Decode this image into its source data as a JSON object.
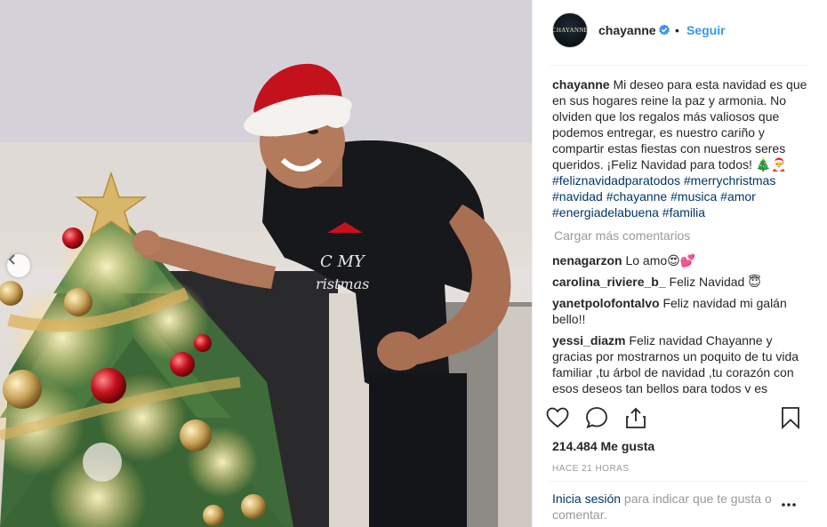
{
  "header": {
    "avatar_text": "CHAYANNE",
    "username": "chayanne",
    "separator": "•",
    "follow_label": "Seguir"
  },
  "caption": {
    "user": "chayanne",
    "text": "Mi deseo para esta navidad es que en sus hogares reine la paz y armonia. No olviden que los regalos más valiosos que podemos entregar, es nuestro cariño y compartir estas fiestas con nuestros seres queridos. ¡Feliz Navidad para todos! 🎄🎅",
    "hashtags": [
      "#feliznavidadparatodos",
      "#merrychristmas",
      "#navidad",
      "#chayanne",
      "#musica",
      "#amor",
      "#energiadelabuena",
      "#familia"
    ]
  },
  "load_more": "Cargar más comentarios",
  "comments": [
    {
      "user": "nenagarzon",
      "text": "Lo amo😍💕"
    },
    {
      "user": "carolina_riviere_b_",
      "text": "Feliz Navidad 😇"
    },
    {
      "user": "yanetpolofontalvo",
      "text": "Feliz navidad mi galán bello!!"
    },
    {
      "user": "yessi_diazm",
      "text": "Feliz navidad Chayanne y gracias por mostrarnos un poquito de tu vida familiar ,tu árbol de navidad ,tu corazón con esos deseos tan bellos para todos y es"
    }
  ],
  "likes": "214.484 Me gusta",
  "timestamp": "HACE 21 HORAS",
  "login_prompt": {
    "link": "Inicia sesión",
    "text": " para indicar que te gusta o comentar."
  },
  "icons": {
    "verified": "verified-badge-icon",
    "like": "heart-icon",
    "comment": "comment-bubble-icon",
    "share": "share-icon",
    "save": "bookmark-icon",
    "more": "more-options-icon",
    "prev": "chevron-left-icon"
  },
  "colors": {
    "accent": "#3897f0",
    "link": "#003569",
    "muted": "#999999",
    "text": "#262626",
    "divider": "#efefef"
  }
}
